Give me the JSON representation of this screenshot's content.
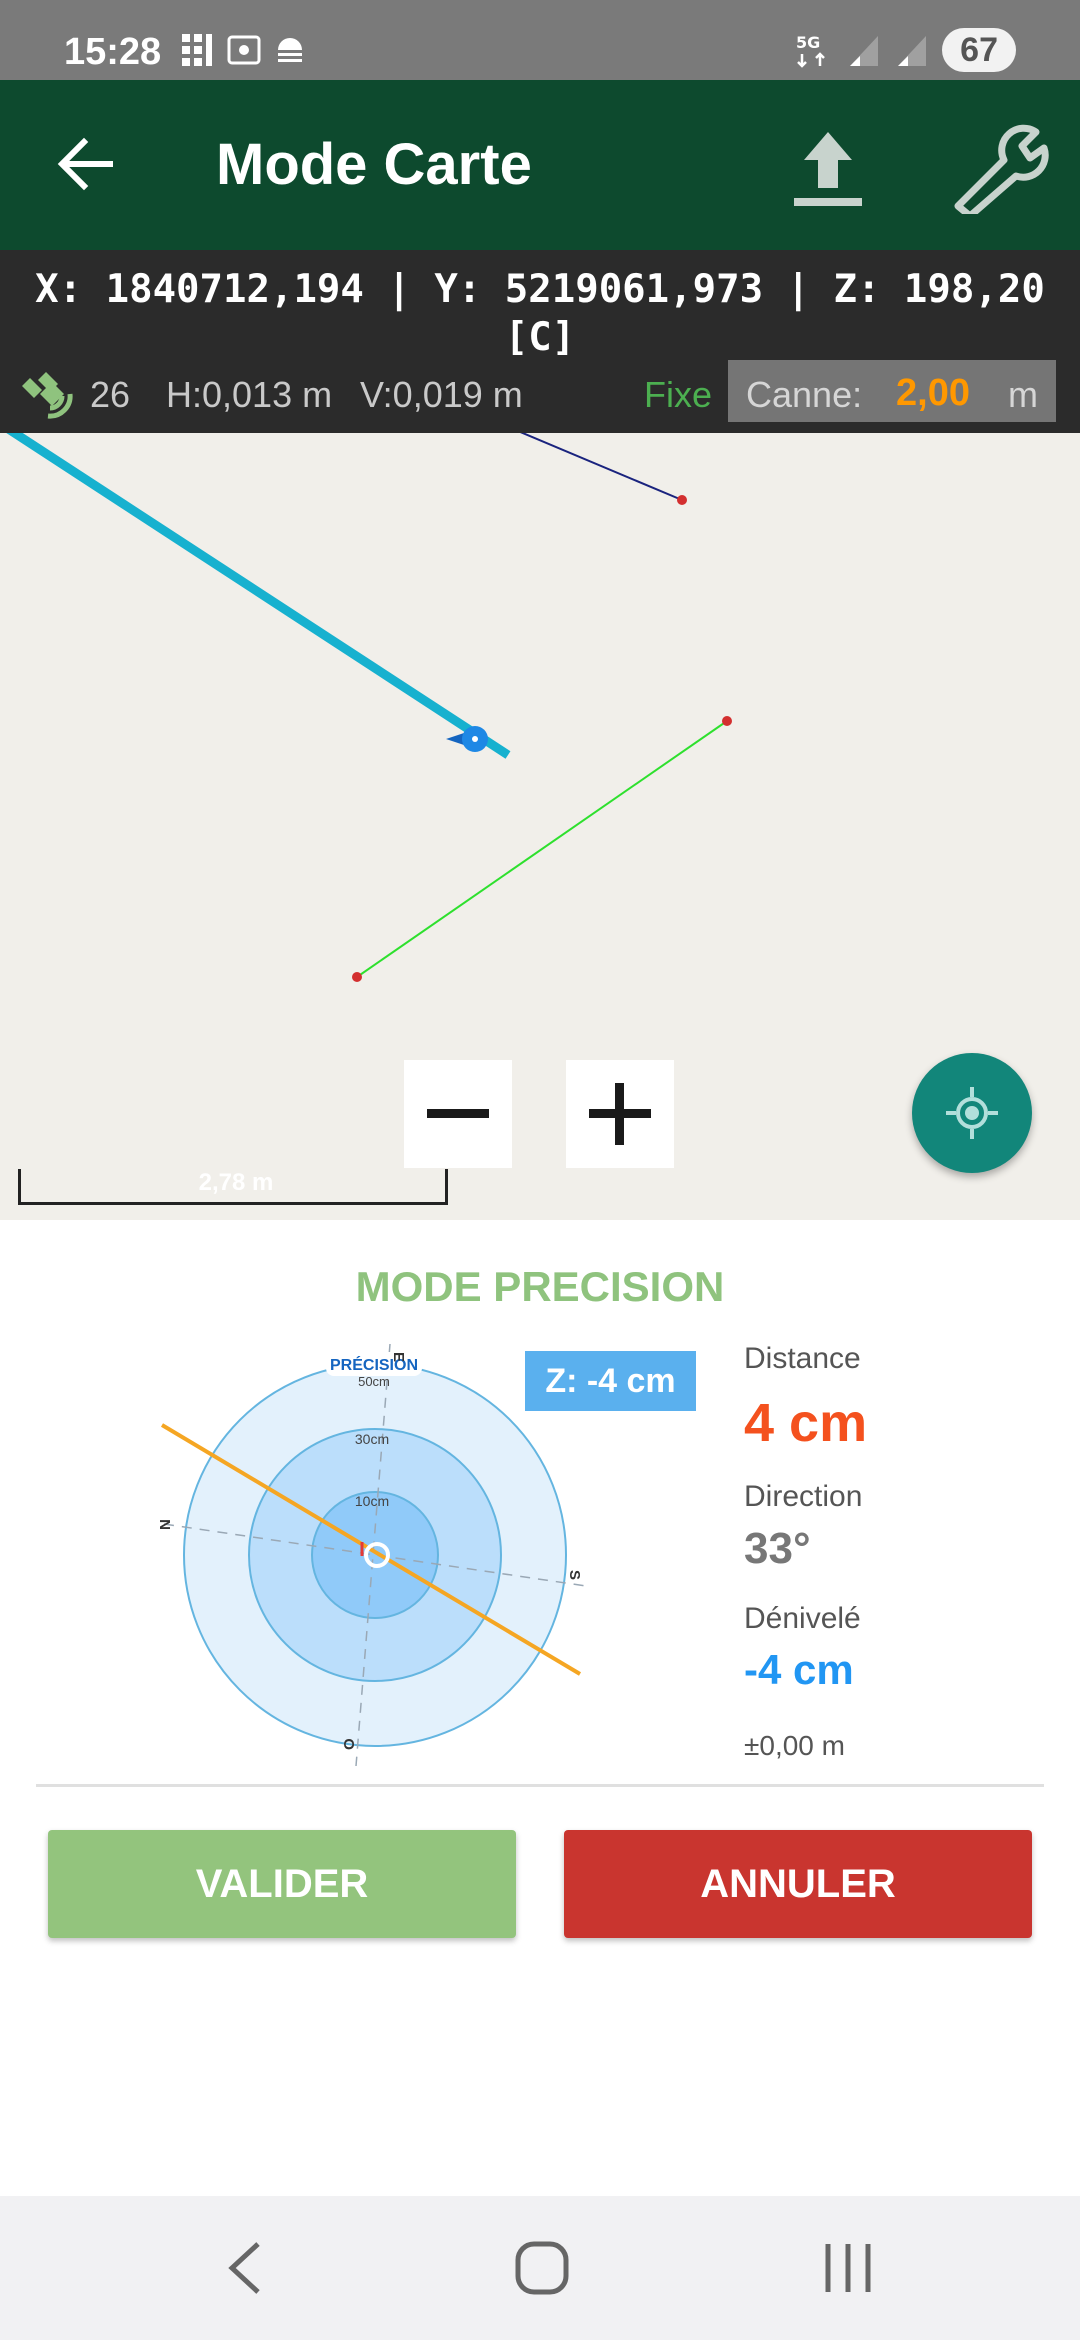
{
  "status_bar": {
    "time": "15:28",
    "battery": "67",
    "network": "5G"
  },
  "app_bar": {
    "title": "Mode Carte"
  },
  "coordinates": {
    "line1": "X: 1840712,194 | Y: 5219061,973 | Z: 198,20",
    "line2": "[C]",
    "satellites": "26",
    "h_precision": "H:0,013 m",
    "v_precision": "V:0,019 m",
    "fix_status": "Fixe",
    "canne_label": "Canne:",
    "canne_value": "2,00",
    "canne_unit": "m"
  },
  "map": {
    "scale_label": "2,78 m"
  },
  "precision": {
    "title": "MODE PRECISION",
    "badge": "PRÉCISION",
    "rings": [
      "10cm",
      "30cm",
      "50cm"
    ],
    "compass": {
      "n": "N",
      "e": "E",
      "s": "S",
      "o": "O"
    },
    "z_badge": "Z: -4 cm",
    "distance_label": "Distance",
    "distance_value": "4 cm",
    "direction_label": "Direction",
    "direction_value": "33°",
    "denivele_label": "Dénivelé",
    "denivele_value": "-4 cm",
    "tolerance": "±0,00 m"
  },
  "actions": {
    "validate": "VALIDER",
    "cancel": "ANNULER"
  },
  "colors": {
    "app_bar": "#0d4a2e",
    "accent_green": "#93c47d",
    "cancel_red": "#c9352f",
    "distance_orange": "#f4511e",
    "denivele_blue": "#2196f3",
    "fab_teal": "#12867a"
  }
}
